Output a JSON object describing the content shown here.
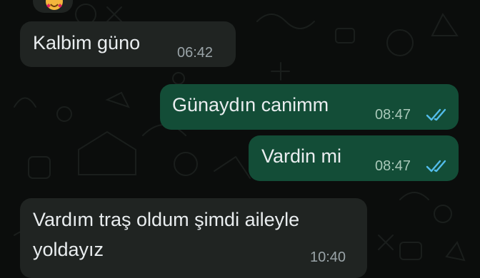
{
  "colors": {
    "chat_background": "#0b0d0c",
    "incoming_bubble": "#202422",
    "outgoing_bubble": "#134d37",
    "text": "#e9edef",
    "read_ticks": "#53bdeb"
  },
  "top_reaction": {
    "icon": "smiling-face-with-hearts-emoji"
  },
  "messages": [
    {
      "direction": "incoming",
      "text": "Kalbim güno",
      "time": "06:42"
    },
    {
      "direction": "outgoing",
      "text": "Günaydın canimm",
      "time": "08:47",
      "status": "read",
      "status_icon": "double-check-icon"
    },
    {
      "direction": "outgoing",
      "text": "Vardin mi",
      "time": "08:47",
      "status": "read",
      "status_icon": "double-check-icon"
    },
    {
      "direction": "incoming",
      "text_line1": "Vardım traş oldum şimdi aileyle",
      "text_line2": "yoldayız",
      "time": "10:40"
    }
  ]
}
